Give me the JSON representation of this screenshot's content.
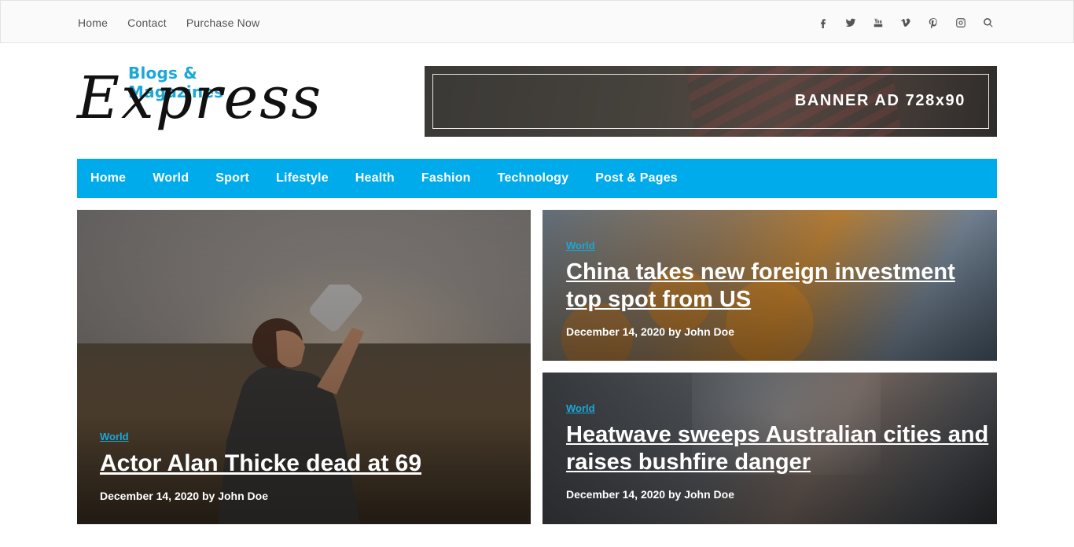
{
  "topbar": {
    "links": [
      "Home",
      "Contact",
      "Purchase Now"
    ],
    "social_icons": [
      "facebook-icon",
      "twitter-icon",
      "youtube-icon",
      "vimeo-icon",
      "pinterest-icon",
      "instagram-icon",
      "search-icon"
    ]
  },
  "logo": {
    "subtitle": "Blogs & Magazines",
    "main": "Express"
  },
  "banner": {
    "text": "BANNER AD 728x90"
  },
  "nav": {
    "items": [
      "Home",
      "World",
      "Sport",
      "Lifestyle",
      "Health",
      "Fashion",
      "Technology",
      "Post & Pages"
    ]
  },
  "colors": {
    "accent": "#00abec",
    "category": "#1ba8d8"
  },
  "posts": [
    {
      "category": "World",
      "title": "Actor Alan Thicke dead at 69",
      "meta": "December 14, 2020 by John Doe"
    },
    {
      "category": "World",
      "title": "China takes new foreign investment top spot from US",
      "meta": "December 14, 2020 by John Doe"
    },
    {
      "category": "World",
      "title": "Heatwave sweeps Australian cities and raises bushfire danger",
      "meta": "December 14, 2020 by John Doe"
    }
  ]
}
